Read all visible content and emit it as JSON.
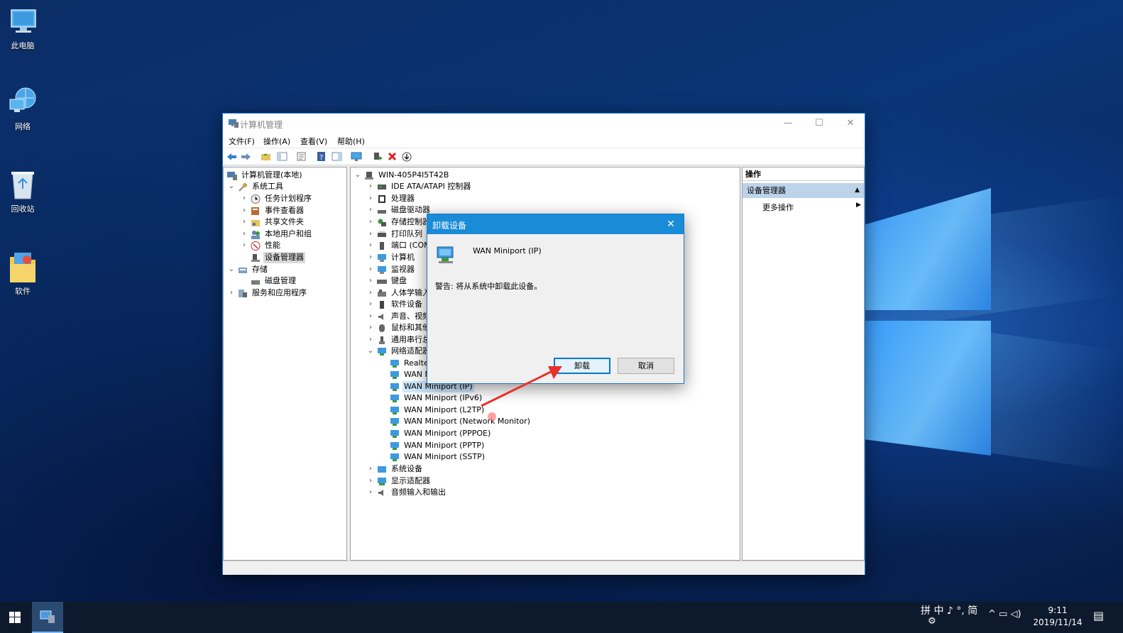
{
  "desktop": {
    "icons": [
      {
        "label": "此电脑",
        "icon": "computer-icon"
      },
      {
        "label": "网络",
        "icon": "network-globe-icon"
      },
      {
        "label": "回收站",
        "icon": "recycle-bin-icon"
      },
      {
        "label": "软件",
        "icon": "folder-icon"
      }
    ]
  },
  "window": {
    "title": "计算机管理",
    "controls": {
      "minimize": "—",
      "maximize": "☐",
      "close": "✕"
    },
    "menu": [
      "文件(F)",
      "操作(A)",
      "查看(V)",
      "帮助(H)"
    ],
    "toolbar_icons": [
      "back-arrow-icon",
      "forward-arrow-icon",
      "up-folder-icon",
      "show-hide-tree-icon",
      "properties-icon",
      "help-icon",
      "action-pane-icon",
      "monitor-icon",
      "add-driver-icon",
      "uninstall-x-icon",
      "download-circle-icon"
    ]
  },
  "left_tree": {
    "root": "计算机管理(本地)",
    "system_tools": "系统工具",
    "task_scheduler": "任务计划程序",
    "event_viewer": "事件查看器",
    "shared_folders": "共享文件夹",
    "local_users": "本地用户和组",
    "performance": "性能",
    "device_manager": "设备管理器",
    "storage": "存储",
    "disk_management": "磁盘管理",
    "services_apps": "服务和应用程序"
  },
  "device_tree": {
    "computer": "WIN-405P4I5T42B",
    "categories": [
      "IDE ATA/ATAPI 控制器",
      "处理器",
      "磁盘驱动器",
      "存储控制器",
      "打印队列",
      "端口 (COM",
      "计算机",
      "监视器",
      "键盘",
      "人体学输入",
      "软件设备",
      "声音、视频",
      "鼠标和其他",
      "通用串行总",
      "网络适配器"
    ],
    "network_children": [
      "Realtek",
      "WAN M",
      "WAN Miniport (IP)",
      "WAN Miniport (IPv6)",
      "WAN Miniport (L2TP)",
      "WAN Miniport (Network Monitor)",
      "WAN Miniport (PPPOE)",
      "WAN Miniport (PPTP)",
      "WAN Miniport (SSTP)"
    ],
    "after": [
      "系统设备",
      "显示适配器",
      "音频输入和输出"
    ]
  },
  "actions": {
    "header": "操作",
    "section": "设备管理器",
    "more": "更多操作"
  },
  "dialog": {
    "title": "卸载设备",
    "close": "✕",
    "device_name": "WAN Miniport (IP)",
    "warning": "警告: 将从系统中卸载此设备。",
    "uninstall_label": "卸载",
    "cancel_label": "取消"
  },
  "taskbar": {
    "ime": "拼 中 ♪ °, 简",
    "tray": "^ ▭ ◁)",
    "time": "9:11",
    "date": "2019/11/14"
  },
  "colors": {
    "accent": "#1a8bd6",
    "selection": "#cce8ff",
    "action_header": "#bcd3ea",
    "arrow": "#e8312a"
  }
}
